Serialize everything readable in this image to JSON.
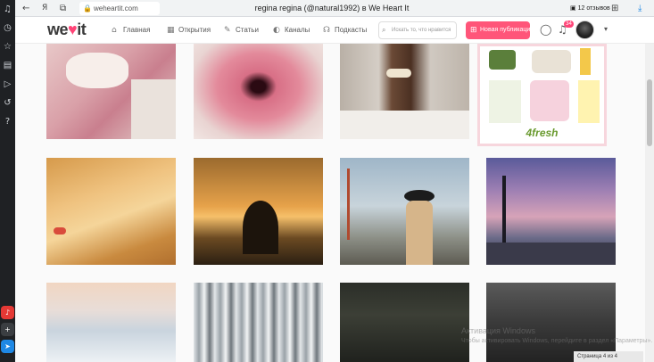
{
  "browser": {
    "back_icon": "arrow-left-icon",
    "profile_label": "Я",
    "url": "weheartit.com",
    "tab_title": "regina regina (@natural1992) в We Heart It",
    "reviews_count": "12",
    "reviews_label": "отзывов"
  },
  "left_rail": {
    "icons": [
      "bell-icon",
      "clock-icon",
      "star-icon",
      "collections-icon",
      "play-icon",
      "history-icon",
      "question-icon"
    ],
    "badges": [
      {
        "name": "music",
        "color": "#e53935"
      },
      {
        "name": "add",
        "color": "#3b3e42"
      },
      {
        "name": "messenger",
        "color": "#1e88e5"
      }
    ]
  },
  "header": {
    "logo": "we",
    "logo_suffix": "it",
    "nav": [
      {
        "label": "Главная",
        "icon": "home-icon"
      },
      {
        "label": "Открытия",
        "icon": "grid-icon"
      },
      {
        "label": "Статьи",
        "icon": "feather-icon"
      },
      {
        "label": "Каналы",
        "icon": "channel-icon"
      },
      {
        "label": "Подкасты",
        "icon": "headphones-icon"
      }
    ],
    "search_placeholder": "Искать то, что нравится",
    "new_post_label": "Новая публикация",
    "notif_count": "34",
    "brand_color": "#ff4477"
  },
  "grid": {
    "rows": [
      [
        {
          "name": "cocoa-marshmallow-mug",
          "visible_text": ""
        },
        {
          "name": "pink-glossy-lips",
          "visible_text": ""
        },
        {
          "name": "hair-ponytail-clip",
          "visible_text": ""
        },
        {
          "name": "4fresh-cosmetics",
          "visible_text": "4fresh"
        }
      ],
      [
        {
          "name": "blonde-braid",
          "visible_text": ""
        },
        {
          "name": "hair-flip-sunset-water",
          "visible_text": ""
        },
        {
          "name": "girl-hat-bridge",
          "visible_text": ""
        },
        {
          "name": "city-evening-lantern",
          "visible_text": ""
        }
      ],
      [
        {
          "name": "snowy-winter-field",
          "visible_text": ""
        },
        {
          "name": "snow-forest",
          "visible_text": ""
        },
        {
          "name": "dark-forest",
          "visible_text": ""
        },
        {
          "name": "dark-trees-bw",
          "visible_text": ""
        }
      ]
    ]
  },
  "overlay": {
    "watermark_title": "Активация Windows",
    "watermark_sub": "Чтобы активировать Windows, перейдите в раздел «Параметры».",
    "bottom_chip": "Страница 4 из 4"
  }
}
